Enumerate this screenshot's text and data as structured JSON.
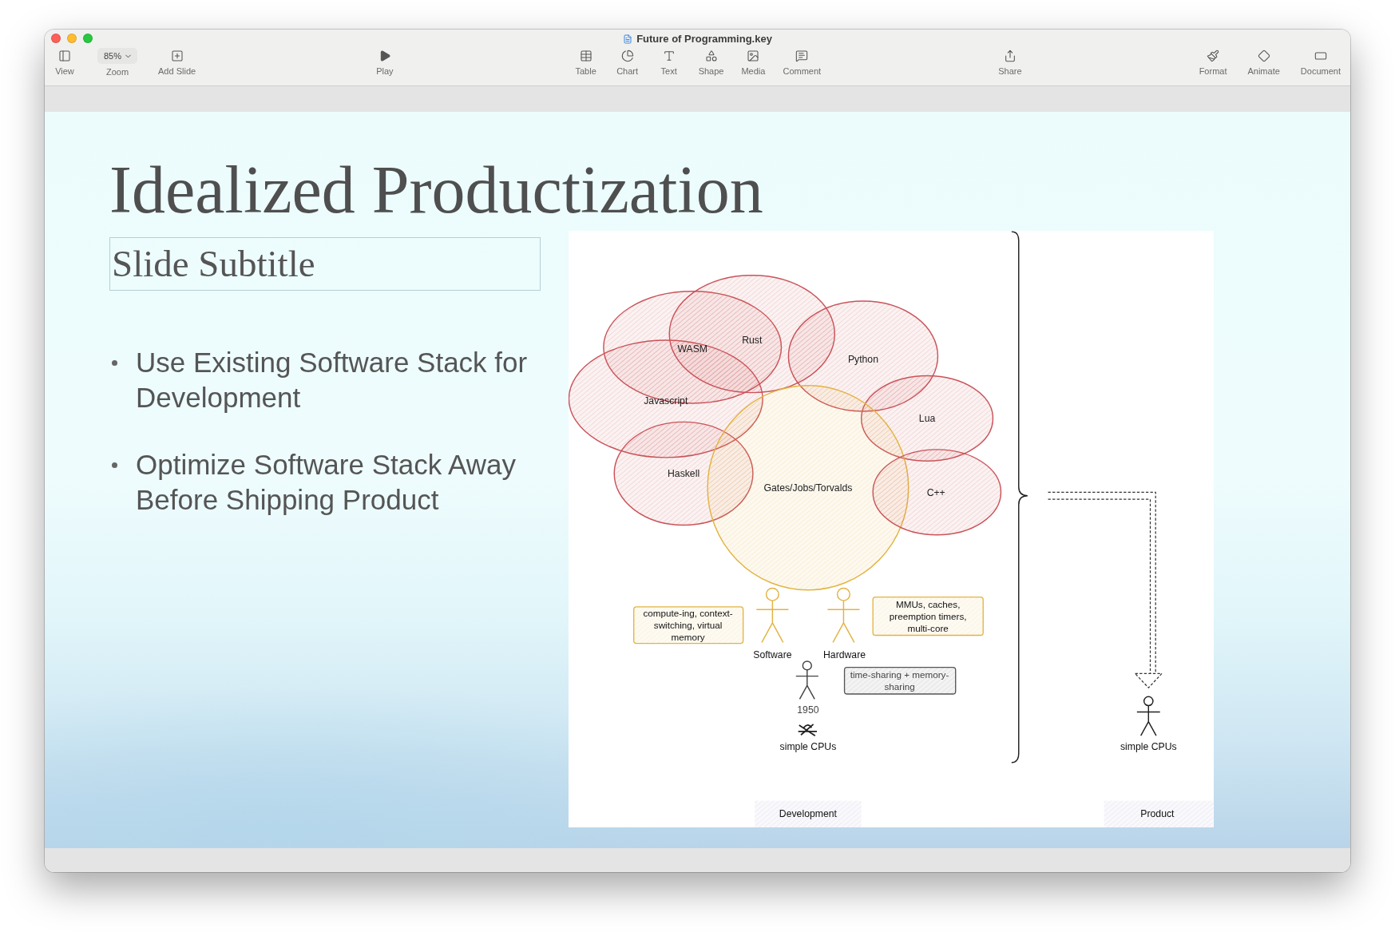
{
  "window": {
    "title": "Future of Programming.key"
  },
  "toolbar": {
    "groups": [
      {
        "items": [
          {
            "label": "View"
          },
          {
            "label": "Zoom",
            "value": "85%"
          },
          {
            "label": "Add Slide"
          }
        ]
      },
      {
        "items": [
          {
            "label": "Play"
          }
        ]
      },
      {
        "items": [
          {
            "label": "Table"
          },
          {
            "label": "Chart"
          },
          {
            "label": "Text"
          },
          {
            "label": "Shape"
          },
          {
            "label": "Media"
          },
          {
            "label": "Comment"
          }
        ]
      },
      {
        "items": [
          {
            "label": "Share"
          }
        ]
      },
      {
        "items": [
          {
            "label": "Format"
          },
          {
            "label": "Animate"
          },
          {
            "label": "Document"
          }
        ]
      }
    ]
  },
  "slide": {
    "title": "Idealized Productization",
    "subtitle": "Slide Subtitle",
    "bullets": [
      "Use Existing Software Stack for Development",
      "Optimize Software Stack Away Before Shipping Product"
    ],
    "diagram": {
      "bubbles": [
        {
          "label": "WASM",
          "color": "#c9545a"
        },
        {
          "label": "Rust",
          "color": "#c9545a"
        },
        {
          "label": "Python",
          "color": "#c9545a"
        },
        {
          "label": "Javascript",
          "color": "#c9545a"
        },
        {
          "label": "Lua",
          "color": "#c9545a"
        },
        {
          "label": "Haskell",
          "color": "#c9545a"
        },
        {
          "label": "Gates/Jobs/Torvalds",
          "color": "#e3b341"
        },
        {
          "label": "C++",
          "color": "#c9545a"
        }
      ],
      "notes": [
        {
          "lines": [
            "compute-ing, context-",
            "switching, virtual",
            "memory"
          ],
          "color": "#e3b341"
        },
        {
          "lines": [
            "MMUs, caches,",
            "preemption timers,",
            "multi-core"
          ],
          "color": "#e3b341"
        },
        {
          "lines": [
            "time-sharing + memory-",
            "sharing"
          ],
          "color": "#555555"
        }
      ],
      "figures": [
        {
          "label": "Software"
        },
        {
          "label": "Hardware"
        },
        {
          "label": "1950"
        }
      ],
      "development_base": "simple CPUs",
      "product_base": "simple CPUs",
      "sections": [
        "Development",
        "Product"
      ]
    }
  }
}
